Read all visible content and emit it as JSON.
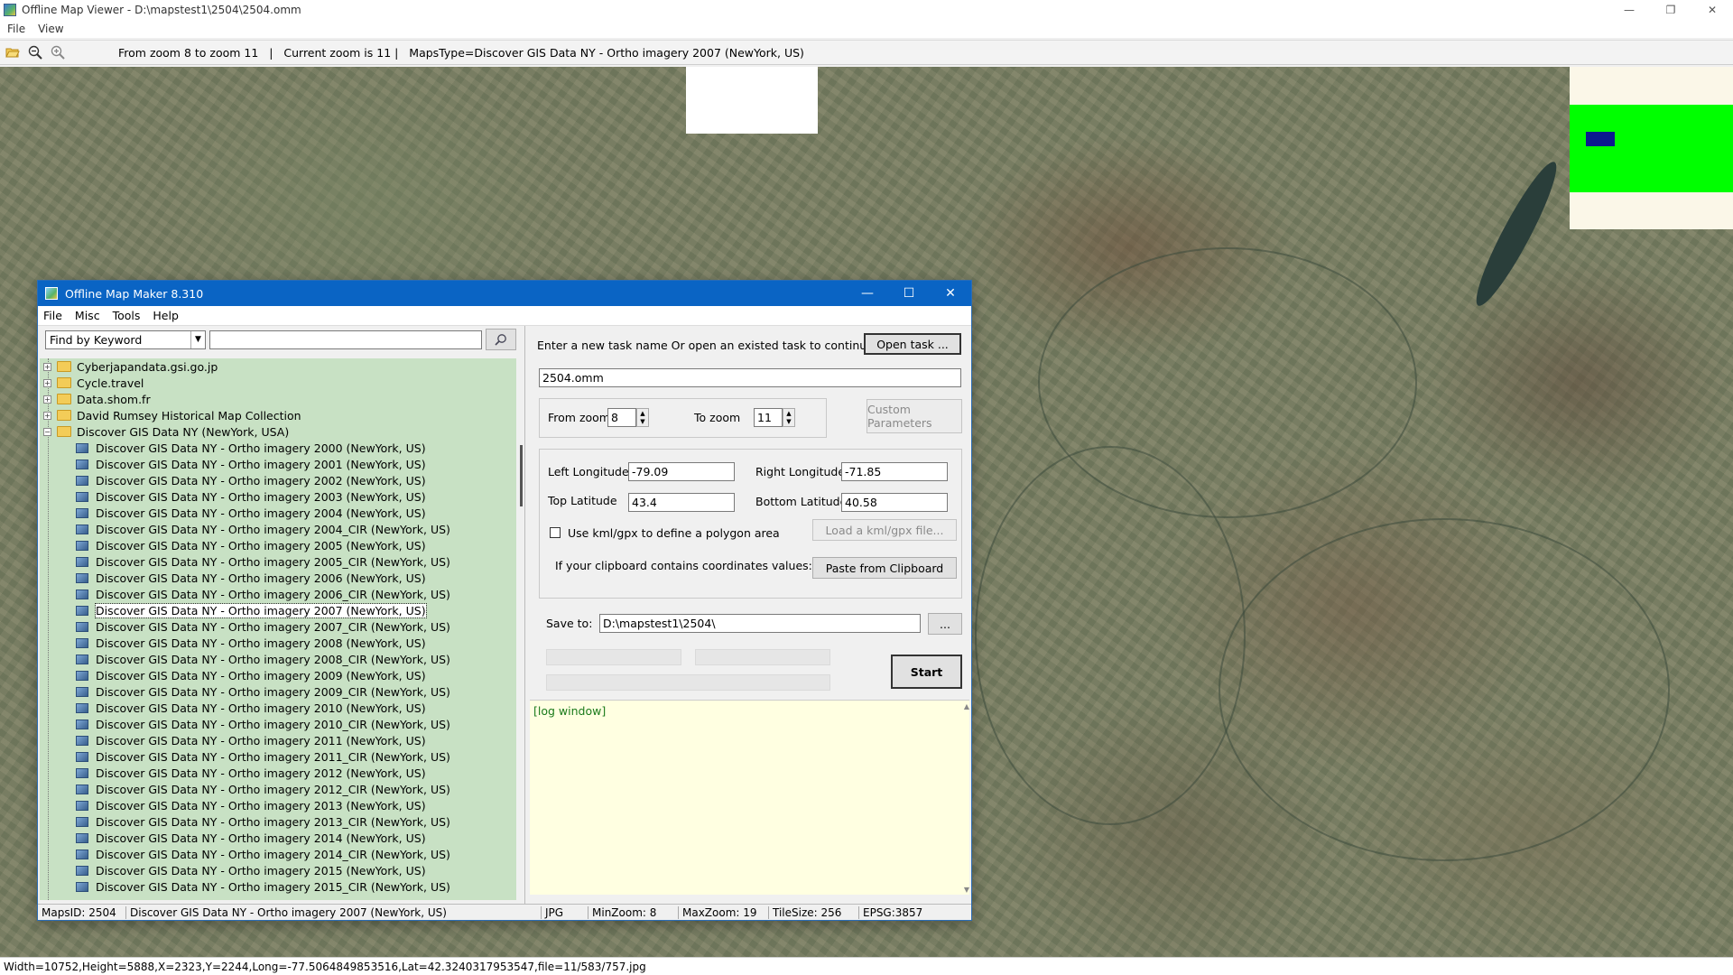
{
  "window": {
    "title": "Offline Map Viewer - D:\\mapstest1\\2504\\2504.omm",
    "minimize": "—",
    "maximize": "❐",
    "close": "✕"
  },
  "menu": [
    "File",
    "View"
  ],
  "toolbar": {
    "open_icon": "folder-open-icon",
    "zoom_out_icon": "zoom-out-icon",
    "zoom_in_icon": "zoom-in-icon",
    "zoom_range": "From zoom 8 to zoom 11",
    "current_zoom": "Current zoom is 11",
    "maps_type": "MapsType=Discover GIS Data NY - Ortho imagery 2007 (NewYork, US)"
  },
  "status_bar": "Width=10752,Height=5888,X=2323,Y=2244,Long=-77.5064849853516,Lat=42.3240317953547,file=11/583/757.jpg",
  "dialog": {
    "title": "Offline Map Maker 8.310",
    "minimize": "—",
    "maximize": "☐",
    "close": "✕",
    "menu": [
      "File",
      "Misc",
      "Tools",
      "Help"
    ],
    "search": {
      "mode": "Find by Keyword",
      "query": ""
    },
    "tree": {
      "folders": [
        "Cyberjapandata.gsi.go.jp",
        "Cycle.travel",
        "Data.shom.fr",
        "David Rumsey Historical Map Collection"
      ],
      "open_folder": "Discover GIS Data NY (NewYork, USA)",
      "items": [
        "Discover GIS Data NY - Ortho imagery 2000 (NewYork, US)",
        "Discover GIS Data NY - Ortho imagery 2001 (NewYork, US)",
        "Discover GIS Data NY - Ortho imagery 2002 (NewYork, US)",
        "Discover GIS Data NY - Ortho imagery 2003 (NewYork, US)",
        "Discover GIS Data NY - Ortho imagery 2004 (NewYork, US)",
        "Discover GIS Data NY - Ortho imagery 2004_CIR (NewYork, US)",
        "Discover GIS Data NY - Ortho imagery 2005 (NewYork, US)",
        "Discover GIS Data NY - Ortho imagery 2005_CIR (NewYork, US)",
        "Discover GIS Data NY - Ortho imagery 2006 (NewYork, US)",
        "Discover GIS Data NY - Ortho imagery 2006_CIR (NewYork, US)",
        "Discover GIS Data NY - Ortho imagery 2007 (NewYork, US)",
        "Discover GIS Data NY - Ortho imagery 2007_CIR (NewYork, US)",
        "Discover GIS Data NY - Ortho imagery 2008 (NewYork, US)",
        "Discover GIS Data NY - Ortho imagery 2008_CIR (NewYork, US)",
        "Discover GIS Data NY - Ortho imagery 2009 (NewYork, US)",
        "Discover GIS Data NY - Ortho imagery 2009_CIR (NewYork, US)",
        "Discover GIS Data NY - Ortho imagery 2010 (NewYork, US)",
        "Discover GIS Data NY - Ortho imagery 2010_CIR (NewYork, US)",
        "Discover GIS Data NY - Ortho imagery 2011 (NewYork, US)",
        "Discover GIS Data NY - Ortho imagery 2011_CIR (NewYork, US)",
        "Discover GIS Data NY - Ortho imagery 2012 (NewYork, US)",
        "Discover GIS Data NY - Ortho imagery 2012_CIR (NewYork, US)",
        "Discover GIS Data NY - Ortho imagery 2013 (NewYork, US)",
        "Discover GIS Data NY - Ortho imagery 2013_CIR (NewYork, US)",
        "Discover GIS Data NY - Ortho imagery 2014 (NewYork, US)",
        "Discover GIS Data NY - Ortho imagery 2014_CIR (NewYork, US)",
        "Discover GIS Data NY - Ortho imagery 2015 (NewYork, US)",
        "Discover GIS Data NY - Ortho imagery 2015_CIR (NewYork, US)"
      ],
      "selected_item": "Discover GIS Data NY - Ortho imagery 2007 (NewYork, US)"
    },
    "form": {
      "task_prompt": "Enter a new task name Or open an existed task to continue:",
      "open_task": "Open task ...",
      "task_name": "2504.omm",
      "from_zoom_label": "From zoom",
      "from_zoom": "8",
      "to_zoom_label": "To zoom",
      "to_zoom": "11",
      "custom_params": "Custom Parameters",
      "left_lon_label": "Left Longitude",
      "left_lon": "-79.09",
      "right_lon_label": "Right Longitude",
      "right_lon": "-71.85",
      "top_lat_label": "Top Latitude",
      "top_lat": "43.4",
      "bottom_lat_label": "Bottom Latitude",
      "bottom_lat": "40.58",
      "kml_label": "Use kml/gpx to define a polygon area",
      "load_kml": "Load a kml/gpx file...",
      "clipboard_label": "If your clipboard contains coordinates values:",
      "paste_clipboard": "Paste from Clipboard",
      "save_to_label": "Save to:",
      "save_to": "D:\\mapstest1\\2504\\",
      "browse": "...",
      "start": "Start",
      "log": "[log window]"
    },
    "status": {
      "maps_id": "MapsID: 2504",
      "map_name": "Discover GIS Data NY - Ortho imagery 2007 (NewYork, US)",
      "format": "JPG",
      "min_zoom": "MinZoom: 8",
      "max_zoom": "MaxZoom: 19",
      "tile_size": "TileSize: 256",
      "epsg": "EPSG:3857"
    }
  },
  "colors": {
    "dialog_titlebar": "#0a64c4",
    "tree_bg": "#c8e1c4",
    "log_bg": "#ffffe1",
    "overview_box": "#00ff00"
  }
}
